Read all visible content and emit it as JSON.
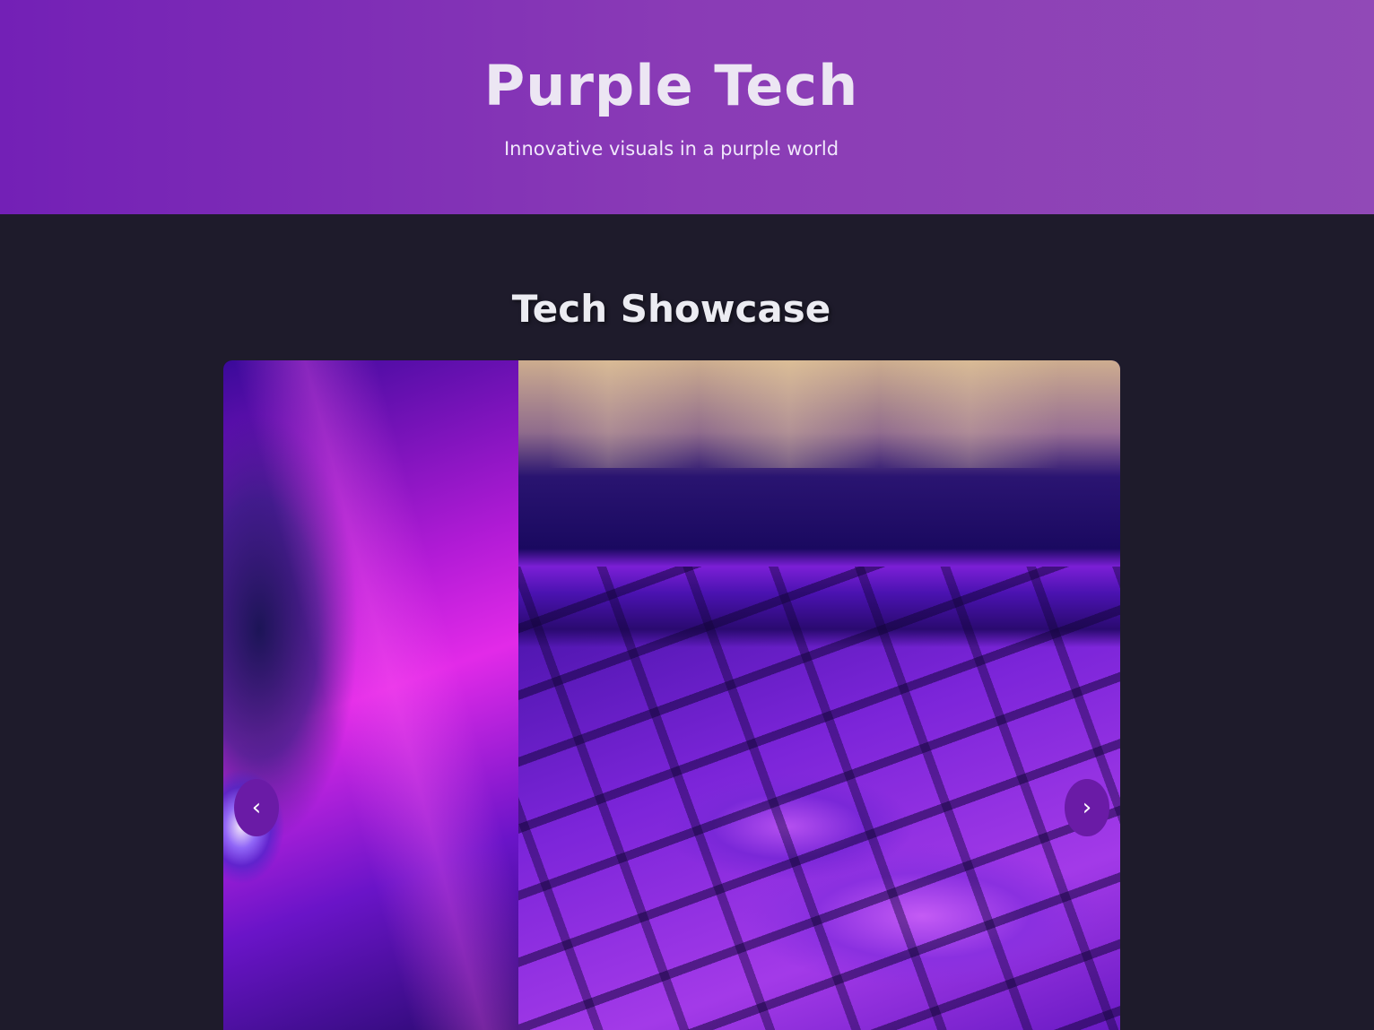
{
  "header": {
    "title": "Purple Tech",
    "subtitle": "Innovative visuals in a purple world"
  },
  "showcase": {
    "title": "Tech Showcase",
    "prev_label": "‹",
    "next_label": "›"
  },
  "colors": {
    "header_gradient_start": "#7320b6",
    "header_gradient_end": "#9149b7",
    "background": "#1e1b2b",
    "nav_button": "#6a1ba6"
  }
}
